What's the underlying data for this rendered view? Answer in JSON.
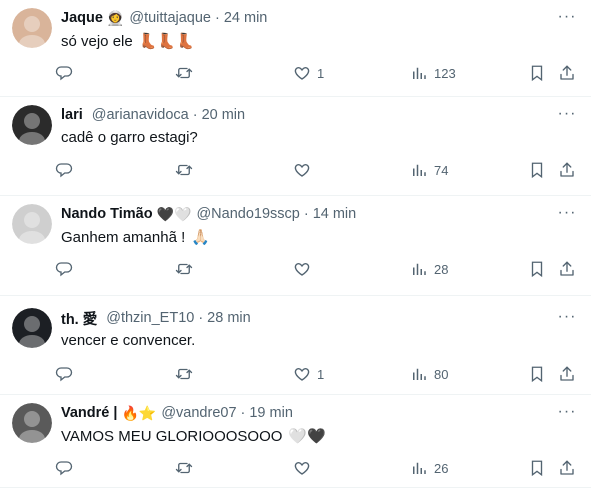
{
  "tweets": [
    {
      "name": "Jaque",
      "badge": "👩‍🚀",
      "handle": "@tuittajaque",
      "dot": "·",
      "time": "24 min",
      "text": "só vejo ele",
      "emoji": "👢👢👢",
      "reply_count": "",
      "retweet_count": "",
      "like_count": "1",
      "view_count": "123",
      "avatar_color": "#d9b49a"
    },
    {
      "name": "lari",
      "badge": "",
      "handle": "@arianavidoca",
      "dot": "·",
      "time": "20 min",
      "text": "cadê o garro estagi?",
      "emoji": "",
      "reply_count": "",
      "retweet_count": "",
      "like_count": "",
      "view_count": "74",
      "avatar_color": "#2b2b2b"
    },
    {
      "name": "Nando Timão",
      "badge": "🖤🤍",
      "handle": "@Nando19sscp",
      "dot": "·",
      "time": "14 min",
      "text": "Ganhem amanhã !",
      "emoji": "🙏🏻",
      "reply_count": "",
      "retweet_count": "",
      "like_count": "",
      "view_count": "28",
      "avatar_color": "#cfcfcf"
    },
    {
      "name": "th. 愛",
      "badge": "",
      "handle": "@thzin_ET10",
      "dot": "·",
      "time": "28 min",
      "text": "vencer e convencer.",
      "emoji": "",
      "reply_count": "",
      "retweet_count": "",
      "like_count": "1",
      "view_count": "80",
      "avatar_color": "#1c1f24"
    },
    {
      "name": "Vandré |",
      "badge": "🔥⭐",
      "handle": "@vandre07",
      "dot": "·",
      "time": "19 min",
      "text": "VAMOS MEU GLORIOOOSOOO",
      "emoji": "🤍🖤",
      "reply_count": "",
      "retweet_count": "",
      "like_count": "",
      "view_count": "26",
      "avatar_color": "#5a5a5a"
    }
  ],
  "icons": {
    "reply": "reply-icon",
    "retweet": "retweet-icon",
    "like": "heart-icon",
    "views": "views-icon",
    "bookmark": "bookmark-icon",
    "share": "share-icon",
    "more": "more-icon"
  },
  "more_label": "···",
  "colors": {
    "text_primary": "#0f1419",
    "text_secondary": "#536471",
    "divider": "#eff3f4"
  }
}
